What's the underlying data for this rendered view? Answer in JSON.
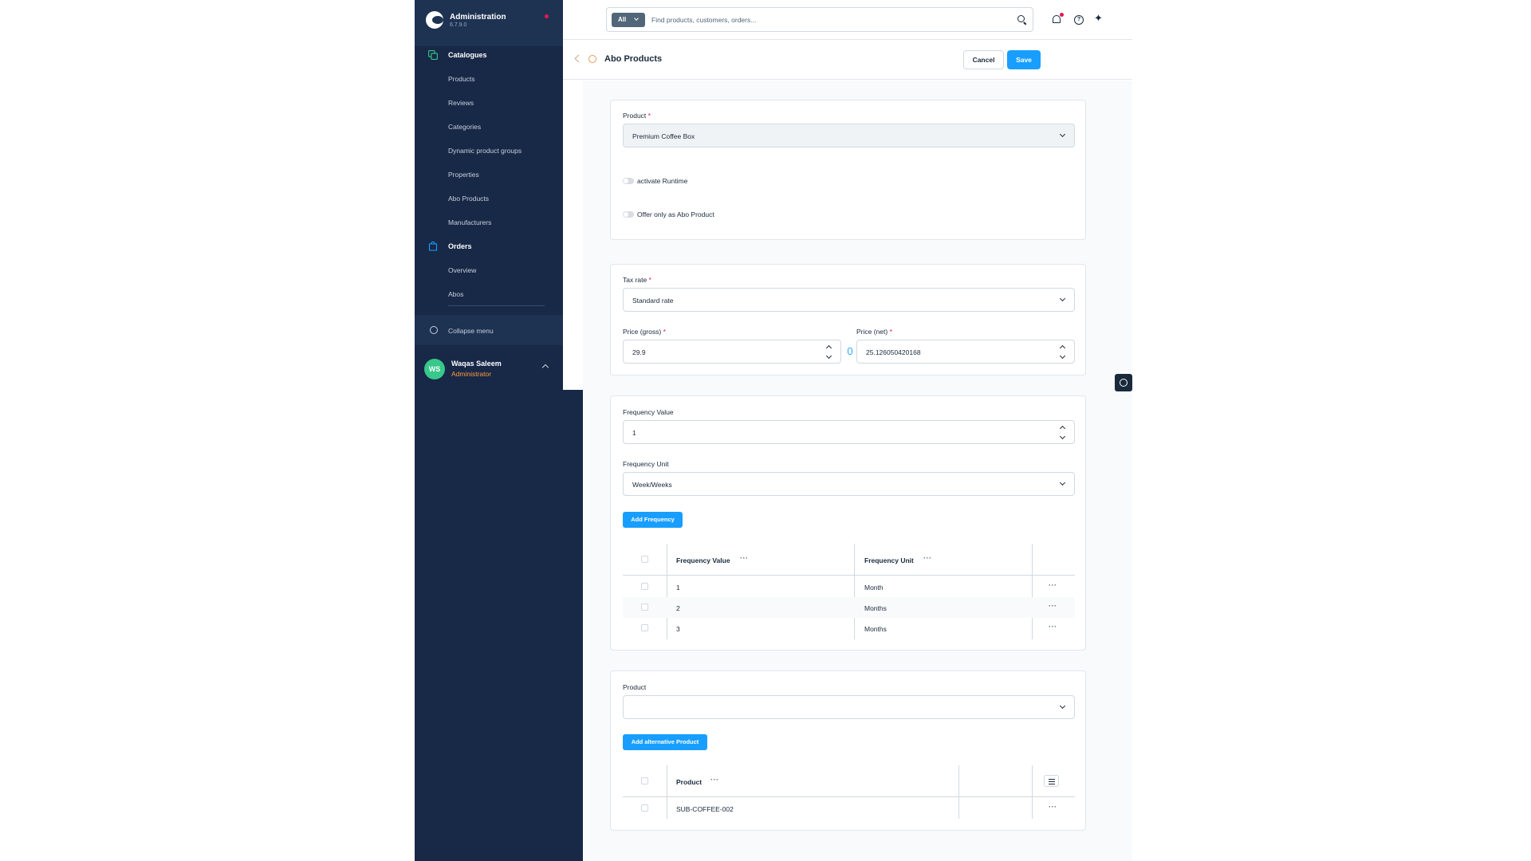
{
  "app": {
    "title": "Administration",
    "version": "6.7.9.0"
  },
  "sidebar": {
    "groups": [
      {
        "label": "Catalogues",
        "items": [
          "Products",
          "Reviews",
          "Categories",
          "Dynamic product groups",
          "Properties",
          "Abo Products",
          "Manufacturers"
        ]
      },
      {
        "label": "Orders",
        "items": [
          "Overview",
          "Abos"
        ]
      }
    ],
    "collapse_label": "Collapse menu",
    "user": {
      "initials": "WS",
      "name": "Waqas Saleem",
      "role": "Administrator"
    }
  },
  "search": {
    "filter_label": "All",
    "placeholder": "Find products, customers, orders..."
  },
  "header": {
    "title": "Abo Products",
    "cancel_label": "Cancel",
    "save_label": "Save"
  },
  "product_card": {
    "product_label": "Product",
    "product_value": "Premium Coffee Box",
    "toggle_runtime_label": "activate Runtime",
    "toggle_offer_label": "Offer only as Abo Product"
  },
  "price_card": {
    "tax_label": "Tax rate",
    "tax_value": "Standard rate",
    "gross_label": "Price (gross)",
    "gross_value": "29.9",
    "net_label": "Price (net)",
    "net_value": "25.126050420168"
  },
  "frequency_card": {
    "value_label": "Frequency Value",
    "value": "1",
    "unit_label": "Frequency Unit",
    "unit_value": "Week/Weeks",
    "add_label": "Add Frequency",
    "columns": [
      "Frequency Value",
      "Frequency Unit"
    ],
    "rows": [
      {
        "value": "1",
        "unit": "Month"
      },
      {
        "value": "2",
        "unit": "Months"
      },
      {
        "value": "3",
        "unit": "Months"
      }
    ]
  },
  "alt_card": {
    "product_label": "Product",
    "product_value": "",
    "add_label": "Add alternative Product",
    "column": "Product",
    "rows": [
      {
        "product": "SUB-COFFEE-002"
      }
    ]
  },
  "colors": {
    "sidebar": "#182847",
    "primary": "#189eff",
    "required": "#e5174f",
    "avatar": "#37c88a",
    "role": "#ff9a3c"
  }
}
